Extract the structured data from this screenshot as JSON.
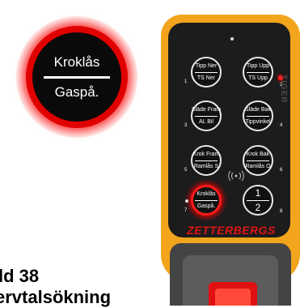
{
  "highlighted_button": {
    "top": "Kroklås",
    "bottom": "Gaspå."
  },
  "caption": {
    "line1": "ld 38",
    "line2": "ervtalsökning"
  },
  "remote": {
    "side_label": "TIGER",
    "brand": "ZETTERBERGS",
    "buttons": [
      {
        "top": "Tipp Ner",
        "bottom": "TS Ner"
      },
      {
        "top": "Tipp Upp",
        "bottom": "TS Upp"
      },
      {
        "top": "Släde Fram",
        "bottom": "AL Bil"
      },
      {
        "top": "Släde Bak",
        "bottom": "Tippvinkel"
      },
      {
        "top": "Krok Fram",
        "bottom": "Ramlås S"
      },
      {
        "top": "Krok Bak",
        "bottom": "Ramlås O"
      },
      {
        "top": "Kroklås",
        "bottom": "Gaspå."
      },
      {
        "top": "1",
        "bottom": "2"
      }
    ],
    "numbers": [
      "1",
      "2",
      "3",
      "4",
      "5",
      "6",
      "7",
      "8"
    ]
  },
  "colors": {
    "body": "#f2a51c",
    "panel": "#1c1c1c",
    "highlight": "#e00000",
    "brand": "#e01515"
  }
}
